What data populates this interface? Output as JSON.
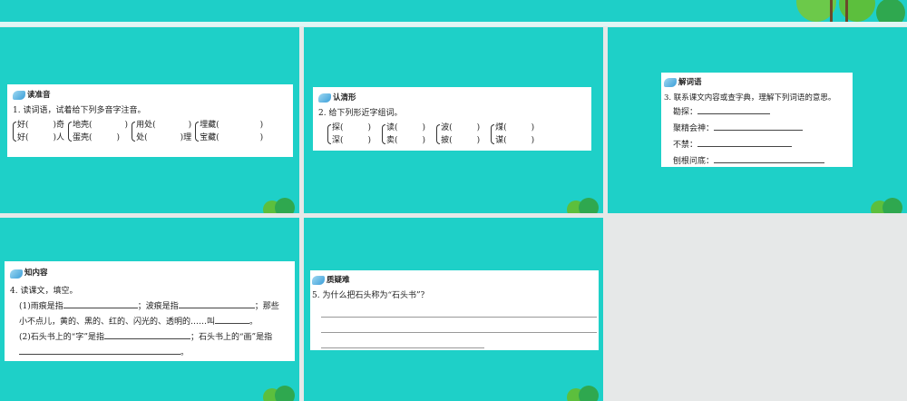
{
  "slide1": {
    "heading": "读准音",
    "question": "1. 读词语，试着给下列多音字注音。",
    "groups": [
      [
        "好(　　　)奇",
        "好(　　　)人"
      ],
      [
        "地壳(　　　　)",
        "蛋壳(　　　)"
      ],
      [
        "用处(　　　　)",
        "处(　　　　)理"
      ],
      [
        "埋藏(　　　　　)",
        "宝藏(　　　　　)"
      ]
    ]
  },
  "slide2": {
    "heading": "认清形",
    "question": "2. 给下列形近字组词。",
    "groups": [
      [
        "探(　　　)",
        "深(　　　)"
      ],
      [
        "读(　　　)",
        "卖(　　　)"
      ],
      [
        "波(　　　)",
        "披(　　　)"
      ],
      [
        "煤(　　　)",
        "谋(　　　)"
      ]
    ]
  },
  "slide3": {
    "heading": "解词语",
    "question": "3. 联系课文内容或查字典，理解下列词语的意思。",
    "terms": [
      "勘探：",
      "聚精会神：",
      "不禁：",
      "刨根问底："
    ]
  },
  "slide4": {
    "heading": "知内容",
    "question": "4. 读课文，填空。",
    "p1a": "(1)雨痕是指",
    "p1b": "；波痕是指",
    "p1c": "；那些",
    "p2a": "小不点儿，黄的、黑的、红的、闪光的、透明的……叫",
    "p2b": "。",
    "p3a": "(2)石头书上的“字”是指",
    "p3b": "；石头书上的“画”是指",
    "p4": "。"
  },
  "slide5": {
    "heading": "质疑难",
    "question": "5. 为什么把石头称为“石头书”？"
  },
  "colors": {
    "teal": "#1ed0c8"
  }
}
